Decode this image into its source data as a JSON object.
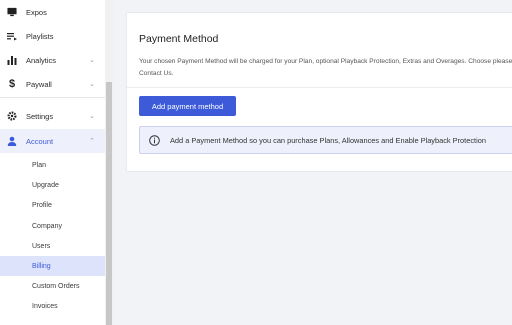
{
  "sidebar": {
    "items": [
      {
        "label": "Expos",
        "icon": "monitor-icon",
        "chevron": ""
      },
      {
        "label": "Playlists",
        "icon": "playlist-icon",
        "chevron": ""
      },
      {
        "label": "Analytics",
        "icon": "bar-chart-icon",
        "chevron": "⌄"
      },
      {
        "label": "Paywall",
        "icon": "dollar-icon",
        "chevron": "⌄"
      },
      {
        "label": "Settings",
        "icon": "gear-icon",
        "chevron": "⌄"
      },
      {
        "label": "Account",
        "icon": "user-icon",
        "chevron": "⌃"
      }
    ],
    "account_sub": [
      "Plan",
      "Upgrade",
      "Profile",
      "Company",
      "Users",
      "Billing",
      "Custom Orders",
      "Invoices"
    ],
    "selected_sub": "Billing"
  },
  "payment": {
    "title": "Payment Method",
    "description": "Your chosen Payment Method will be charged for your Plan, optional Playback Protection, Extras and Overages. Choose please Contact Us.",
    "add_button": "Add payment method",
    "info": "Add a Payment Method so you can purchase Plans, Allowances and Enable Playback Protection"
  },
  "colors": {
    "accent": "#3d5bd9",
    "active_bg": "#eef0fb",
    "selected_bg": "#dde3fb",
    "info_bg": "#eef1fc"
  }
}
